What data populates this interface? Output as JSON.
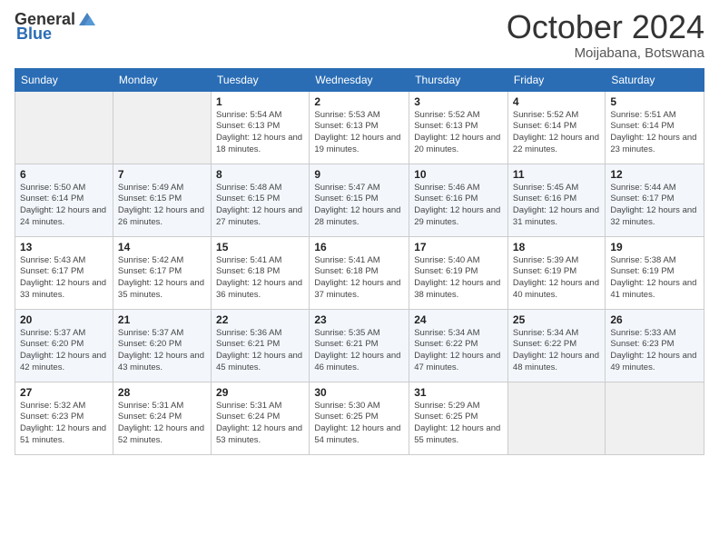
{
  "header": {
    "logo_general": "General",
    "logo_blue": "Blue",
    "title": "October 2024",
    "location": "Moijabana, Botswana"
  },
  "days_of_week": [
    "Sunday",
    "Monday",
    "Tuesday",
    "Wednesday",
    "Thursday",
    "Friday",
    "Saturday"
  ],
  "weeks": [
    [
      {
        "day": "",
        "sunrise": "",
        "sunset": "",
        "daylight": "",
        "empty": true
      },
      {
        "day": "",
        "sunrise": "",
        "sunset": "",
        "daylight": "",
        "empty": true
      },
      {
        "day": "1",
        "sunrise": "Sunrise: 5:54 AM",
        "sunset": "Sunset: 6:13 PM",
        "daylight": "Daylight: 12 hours and 18 minutes."
      },
      {
        "day": "2",
        "sunrise": "Sunrise: 5:53 AM",
        "sunset": "Sunset: 6:13 PM",
        "daylight": "Daylight: 12 hours and 19 minutes."
      },
      {
        "day": "3",
        "sunrise": "Sunrise: 5:52 AM",
        "sunset": "Sunset: 6:13 PM",
        "daylight": "Daylight: 12 hours and 20 minutes."
      },
      {
        "day": "4",
        "sunrise": "Sunrise: 5:52 AM",
        "sunset": "Sunset: 6:14 PM",
        "daylight": "Daylight: 12 hours and 22 minutes."
      },
      {
        "day": "5",
        "sunrise": "Sunrise: 5:51 AM",
        "sunset": "Sunset: 6:14 PM",
        "daylight": "Daylight: 12 hours and 23 minutes."
      }
    ],
    [
      {
        "day": "6",
        "sunrise": "Sunrise: 5:50 AM",
        "sunset": "Sunset: 6:14 PM",
        "daylight": "Daylight: 12 hours and 24 minutes."
      },
      {
        "day": "7",
        "sunrise": "Sunrise: 5:49 AM",
        "sunset": "Sunset: 6:15 PM",
        "daylight": "Daylight: 12 hours and 26 minutes."
      },
      {
        "day": "8",
        "sunrise": "Sunrise: 5:48 AM",
        "sunset": "Sunset: 6:15 PM",
        "daylight": "Daylight: 12 hours and 27 minutes."
      },
      {
        "day": "9",
        "sunrise": "Sunrise: 5:47 AM",
        "sunset": "Sunset: 6:15 PM",
        "daylight": "Daylight: 12 hours and 28 minutes."
      },
      {
        "day": "10",
        "sunrise": "Sunrise: 5:46 AM",
        "sunset": "Sunset: 6:16 PM",
        "daylight": "Daylight: 12 hours and 29 minutes."
      },
      {
        "day": "11",
        "sunrise": "Sunrise: 5:45 AM",
        "sunset": "Sunset: 6:16 PM",
        "daylight": "Daylight: 12 hours and 31 minutes."
      },
      {
        "day": "12",
        "sunrise": "Sunrise: 5:44 AM",
        "sunset": "Sunset: 6:17 PM",
        "daylight": "Daylight: 12 hours and 32 minutes."
      }
    ],
    [
      {
        "day": "13",
        "sunrise": "Sunrise: 5:43 AM",
        "sunset": "Sunset: 6:17 PM",
        "daylight": "Daylight: 12 hours and 33 minutes."
      },
      {
        "day": "14",
        "sunrise": "Sunrise: 5:42 AM",
        "sunset": "Sunset: 6:17 PM",
        "daylight": "Daylight: 12 hours and 35 minutes."
      },
      {
        "day": "15",
        "sunrise": "Sunrise: 5:41 AM",
        "sunset": "Sunset: 6:18 PM",
        "daylight": "Daylight: 12 hours and 36 minutes."
      },
      {
        "day": "16",
        "sunrise": "Sunrise: 5:41 AM",
        "sunset": "Sunset: 6:18 PM",
        "daylight": "Daylight: 12 hours and 37 minutes."
      },
      {
        "day": "17",
        "sunrise": "Sunrise: 5:40 AM",
        "sunset": "Sunset: 6:19 PM",
        "daylight": "Daylight: 12 hours and 38 minutes."
      },
      {
        "day": "18",
        "sunrise": "Sunrise: 5:39 AM",
        "sunset": "Sunset: 6:19 PM",
        "daylight": "Daylight: 12 hours and 40 minutes."
      },
      {
        "day": "19",
        "sunrise": "Sunrise: 5:38 AM",
        "sunset": "Sunset: 6:19 PM",
        "daylight": "Daylight: 12 hours and 41 minutes."
      }
    ],
    [
      {
        "day": "20",
        "sunrise": "Sunrise: 5:37 AM",
        "sunset": "Sunset: 6:20 PM",
        "daylight": "Daylight: 12 hours and 42 minutes."
      },
      {
        "day": "21",
        "sunrise": "Sunrise: 5:37 AM",
        "sunset": "Sunset: 6:20 PM",
        "daylight": "Daylight: 12 hours and 43 minutes."
      },
      {
        "day": "22",
        "sunrise": "Sunrise: 5:36 AM",
        "sunset": "Sunset: 6:21 PM",
        "daylight": "Daylight: 12 hours and 45 minutes."
      },
      {
        "day": "23",
        "sunrise": "Sunrise: 5:35 AM",
        "sunset": "Sunset: 6:21 PM",
        "daylight": "Daylight: 12 hours and 46 minutes."
      },
      {
        "day": "24",
        "sunrise": "Sunrise: 5:34 AM",
        "sunset": "Sunset: 6:22 PM",
        "daylight": "Daylight: 12 hours and 47 minutes."
      },
      {
        "day": "25",
        "sunrise": "Sunrise: 5:34 AM",
        "sunset": "Sunset: 6:22 PM",
        "daylight": "Daylight: 12 hours and 48 minutes."
      },
      {
        "day": "26",
        "sunrise": "Sunrise: 5:33 AM",
        "sunset": "Sunset: 6:23 PM",
        "daylight": "Daylight: 12 hours and 49 minutes."
      }
    ],
    [
      {
        "day": "27",
        "sunrise": "Sunrise: 5:32 AM",
        "sunset": "Sunset: 6:23 PM",
        "daylight": "Daylight: 12 hours and 51 minutes."
      },
      {
        "day": "28",
        "sunrise": "Sunrise: 5:31 AM",
        "sunset": "Sunset: 6:24 PM",
        "daylight": "Daylight: 12 hours and 52 minutes."
      },
      {
        "day": "29",
        "sunrise": "Sunrise: 5:31 AM",
        "sunset": "Sunset: 6:24 PM",
        "daylight": "Daylight: 12 hours and 53 minutes."
      },
      {
        "day": "30",
        "sunrise": "Sunrise: 5:30 AM",
        "sunset": "Sunset: 6:25 PM",
        "daylight": "Daylight: 12 hours and 54 minutes."
      },
      {
        "day": "31",
        "sunrise": "Sunrise: 5:29 AM",
        "sunset": "Sunset: 6:25 PM",
        "daylight": "Daylight: 12 hours and 55 minutes."
      },
      {
        "day": "",
        "sunrise": "",
        "sunset": "",
        "daylight": "",
        "empty": true
      },
      {
        "day": "",
        "sunrise": "",
        "sunset": "",
        "daylight": "",
        "empty": true
      }
    ]
  ]
}
